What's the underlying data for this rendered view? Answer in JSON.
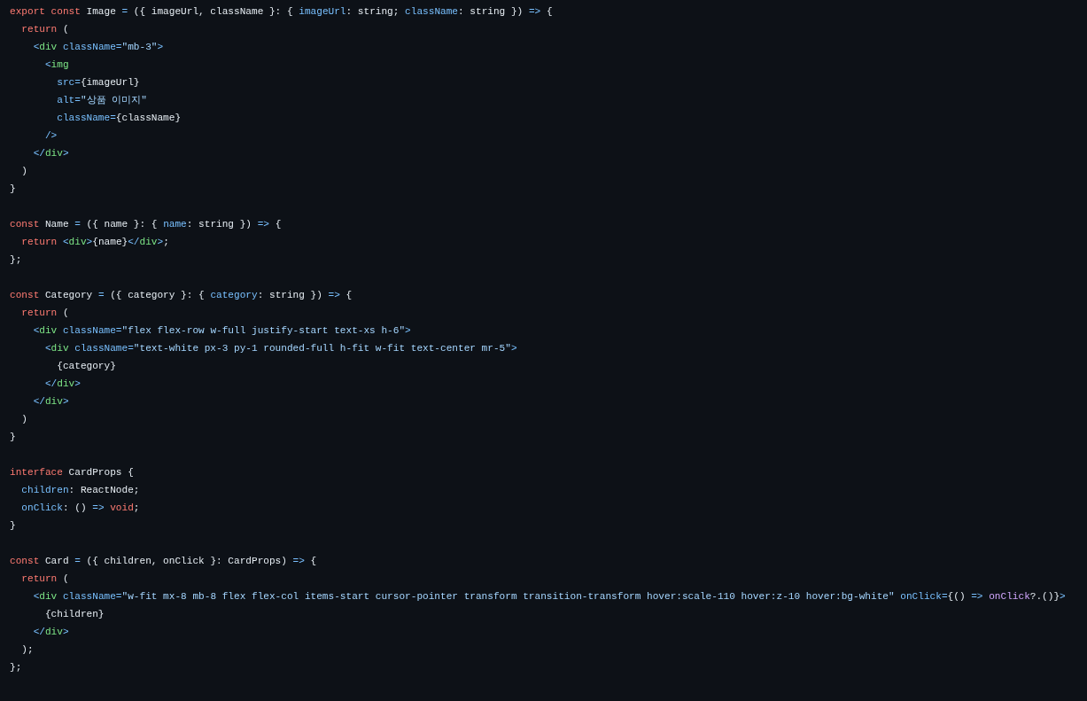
{
  "code_blocks": [
    {
      "lines": [
        [
          {
            "kind": "keyword",
            "text": "export const"
          },
          {
            "kind": "plain",
            "text": " Image "
          },
          {
            "kind": "op",
            "text": "="
          },
          {
            "kind": "plain",
            "text": " ({ imageUrl, className }: { "
          },
          {
            "kind": "op",
            "text": "imageUrl"
          },
          {
            "kind": "plain",
            "text": ": string; "
          },
          {
            "kind": "op",
            "text": "className"
          },
          {
            "kind": "plain",
            "text": ": string }) "
          },
          {
            "kind": "op",
            "text": "=>"
          },
          {
            "kind": "plain",
            "text": " {"
          }
        ],
        [
          {
            "kind": "keyword",
            "text": "  return"
          },
          {
            "kind": "plain",
            "text": " ("
          }
        ],
        [
          {
            "kind": "op",
            "text": "    <"
          },
          {
            "kind": "tag",
            "text": "div"
          },
          {
            "kind": "op",
            "text": " className="
          },
          {
            "kind": "string",
            "text": "\"mb-3\""
          },
          {
            "kind": "op",
            "text": ">"
          }
        ],
        [
          {
            "kind": "op",
            "text": "      <"
          },
          {
            "kind": "tag",
            "text": "img"
          }
        ],
        [
          {
            "kind": "op",
            "text": "        src="
          },
          {
            "kind": "plain",
            "text": "{imageUrl}"
          }
        ],
        [
          {
            "kind": "op",
            "text": "        alt="
          },
          {
            "kind": "string",
            "text": "\"상품 이미지\""
          }
        ],
        [
          {
            "kind": "op",
            "text": "        className="
          },
          {
            "kind": "plain",
            "text": "{className}"
          }
        ],
        [
          {
            "kind": "op",
            "text": "      />"
          }
        ],
        [
          {
            "kind": "op",
            "text": "    </"
          },
          {
            "kind": "tag",
            "text": "div"
          },
          {
            "kind": "op",
            "text": ">"
          }
        ],
        [
          {
            "kind": "plain",
            "text": "  )"
          }
        ],
        [
          {
            "kind": "plain",
            "text": "}"
          }
        ]
      ]
    },
    {
      "lines": [
        [
          {
            "kind": "keyword",
            "text": "const"
          },
          {
            "kind": "plain",
            "text": " Name "
          },
          {
            "kind": "op",
            "text": "="
          },
          {
            "kind": "plain",
            "text": " ({ name }: { "
          },
          {
            "kind": "op",
            "text": "name"
          },
          {
            "kind": "plain",
            "text": ": string }) "
          },
          {
            "kind": "op",
            "text": "=>"
          },
          {
            "kind": "plain",
            "text": " {"
          }
        ],
        [
          {
            "kind": "keyword",
            "text": "  return"
          },
          {
            "kind": "op",
            "text": " <"
          },
          {
            "kind": "tag",
            "text": "div"
          },
          {
            "kind": "op",
            "text": ">"
          },
          {
            "kind": "plain",
            "text": "{name}"
          },
          {
            "kind": "op",
            "text": "</"
          },
          {
            "kind": "tag",
            "text": "div"
          },
          {
            "kind": "op",
            "text": ">"
          },
          {
            "kind": "plain",
            "text": ";"
          }
        ],
        [
          {
            "kind": "plain",
            "text": "};"
          }
        ]
      ]
    },
    {
      "lines": [
        [
          {
            "kind": "keyword",
            "text": "const"
          },
          {
            "kind": "plain",
            "text": " Category "
          },
          {
            "kind": "op",
            "text": "="
          },
          {
            "kind": "plain",
            "text": " ({ category }: { "
          },
          {
            "kind": "op",
            "text": "category"
          },
          {
            "kind": "plain",
            "text": ": string }) "
          },
          {
            "kind": "op",
            "text": "=>"
          },
          {
            "kind": "plain",
            "text": " {"
          }
        ],
        [
          {
            "kind": "keyword",
            "text": "  return"
          },
          {
            "kind": "plain",
            "text": " ("
          }
        ],
        [
          {
            "kind": "op",
            "text": "    <"
          },
          {
            "kind": "tag",
            "text": "div"
          },
          {
            "kind": "op",
            "text": " className="
          },
          {
            "kind": "string",
            "text": "\"flex flex-row w-full justify-start text-xs h-6\""
          },
          {
            "kind": "op",
            "text": ">"
          }
        ],
        [
          {
            "kind": "op",
            "text": "      <"
          },
          {
            "kind": "tag",
            "text": "div"
          },
          {
            "kind": "op",
            "text": " className="
          },
          {
            "kind": "string",
            "text": "\"text-white px-3 py-1 rounded-full h-fit w-fit text-center mr-5\""
          },
          {
            "kind": "op",
            "text": ">"
          }
        ],
        [
          {
            "kind": "plain",
            "text": "        {category}"
          }
        ],
        [
          {
            "kind": "op",
            "text": "      </"
          },
          {
            "kind": "tag",
            "text": "div"
          },
          {
            "kind": "op",
            "text": ">"
          }
        ],
        [
          {
            "kind": "op",
            "text": "    </"
          },
          {
            "kind": "tag",
            "text": "div"
          },
          {
            "kind": "op",
            "text": ">"
          }
        ],
        [
          {
            "kind": "plain",
            "text": "  )"
          }
        ],
        [
          {
            "kind": "plain",
            "text": "}"
          }
        ]
      ]
    },
    {
      "lines": [
        [
          {
            "kind": "keyword",
            "text": "interface"
          },
          {
            "kind": "plain",
            "text": " CardProps {"
          }
        ],
        [
          {
            "kind": "op",
            "text": "  children"
          },
          {
            "kind": "plain",
            "text": ": ReactNode;"
          }
        ],
        [
          {
            "kind": "op",
            "text": "  onClick"
          },
          {
            "kind": "plain",
            "text": ": () "
          },
          {
            "kind": "op",
            "text": "=>"
          },
          {
            "kind": "keyword",
            "text": " void"
          },
          {
            "kind": "plain",
            "text": ";"
          }
        ],
        [
          {
            "kind": "plain",
            "text": "}"
          }
        ]
      ]
    },
    {
      "lines": [
        [
          {
            "kind": "keyword",
            "text": "const"
          },
          {
            "kind": "plain",
            "text": " Card "
          },
          {
            "kind": "op",
            "text": "="
          },
          {
            "kind": "plain",
            "text": " ({ children, onClick }: CardProps) "
          },
          {
            "kind": "op",
            "text": "=>"
          },
          {
            "kind": "plain",
            "text": " {"
          }
        ],
        [
          {
            "kind": "keyword",
            "text": "  return"
          },
          {
            "kind": "plain",
            "text": " ("
          }
        ],
        [
          {
            "kind": "op",
            "text": "    <"
          },
          {
            "kind": "tag",
            "text": "div"
          },
          {
            "kind": "op",
            "text": " className="
          },
          {
            "kind": "string",
            "text": "\"w-fit mx-8 mb-8 flex flex-col items-start cursor-pointer transform transition-transform hover:scale-110 hover:z-10 hover:bg-white\""
          },
          {
            "kind": "op",
            "text": " onClick="
          },
          {
            "kind": "plain",
            "text": "{() "
          },
          {
            "kind": "op",
            "text": "=>"
          },
          {
            "kind": "func",
            "text": " onClick"
          },
          {
            "kind": "plain",
            "text": "?.()}"
          },
          {
            "kind": "op",
            "text": ">"
          }
        ],
        [
          {
            "kind": "plain",
            "text": "      {children}"
          }
        ],
        [
          {
            "kind": "op",
            "text": "    </"
          },
          {
            "kind": "tag",
            "text": "div"
          },
          {
            "kind": "op",
            "text": ">"
          }
        ],
        [
          {
            "kind": "plain",
            "text": "  );"
          }
        ],
        [
          {
            "kind": "plain",
            "text": "};"
          }
        ]
      ]
    }
  ]
}
